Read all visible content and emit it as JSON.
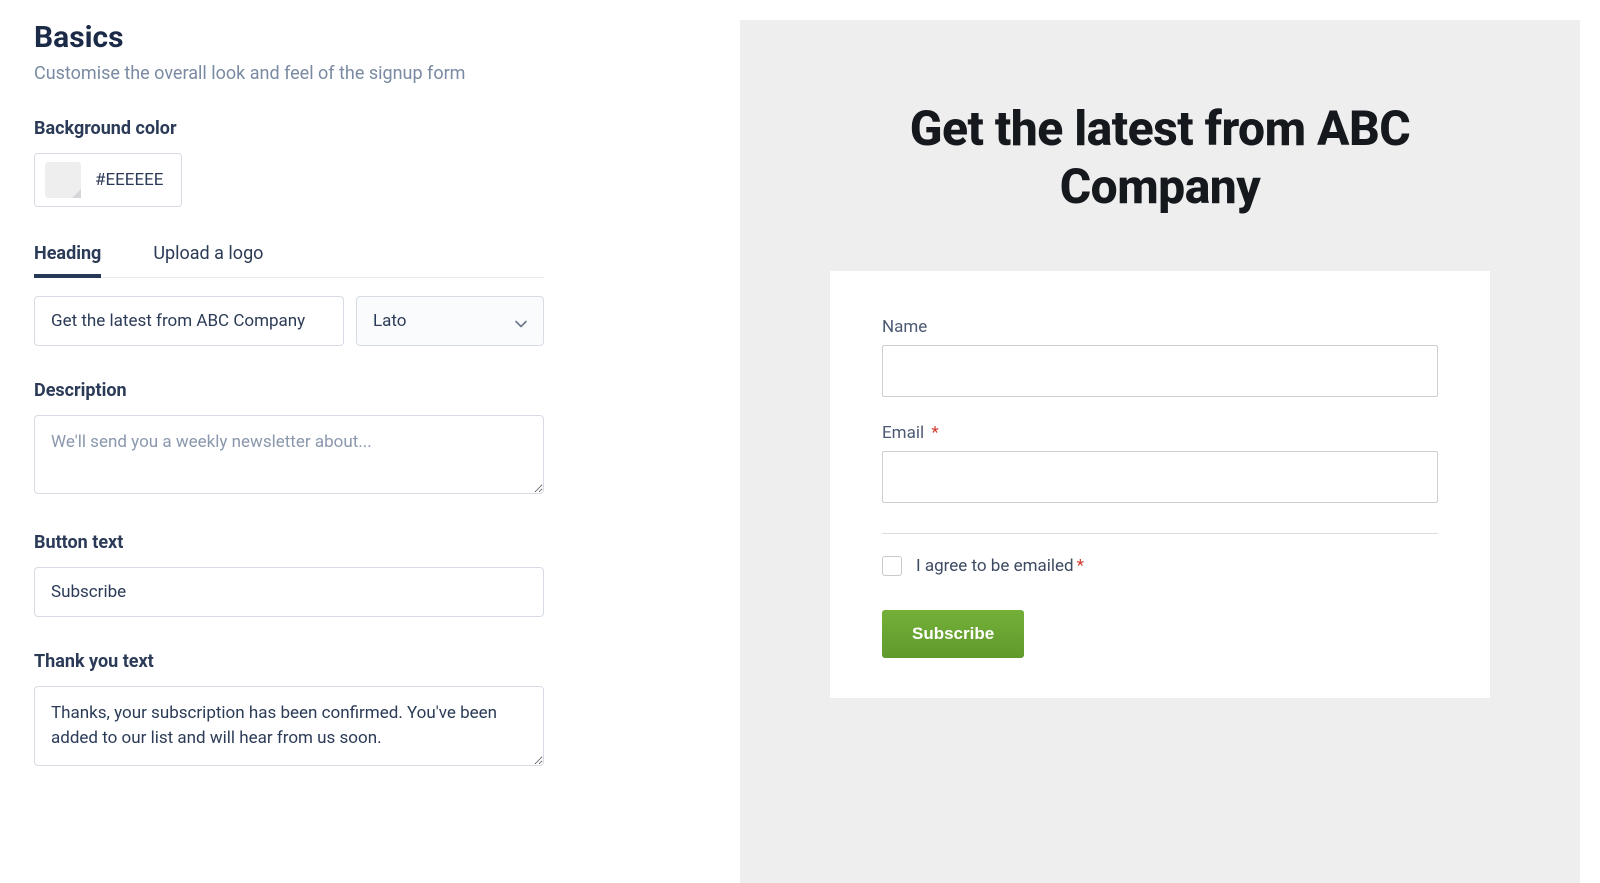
{
  "left": {
    "title": "Basics",
    "subtitle": "Customise the overall look and feel of the signup form",
    "bg_label": "Background color",
    "bg_value": "#EEEEEE",
    "tabs": {
      "heading": "Heading",
      "logo": "Upload a logo"
    },
    "heading_value": "Get the latest from ABC Company",
    "font_selected": "Lato",
    "desc_label": "Description",
    "desc_placeholder": "We'll send you a weekly newsletter about...",
    "desc_value": "",
    "button_label": "Button text",
    "button_value": "Subscribe",
    "thanks_label": "Thank you text",
    "thanks_value": "Thanks, your subscription has been confirmed. You've been added to our list and will hear from us soon."
  },
  "preview": {
    "heading": "Get the latest from ABC Company",
    "name_label": "Name",
    "email_label": "Email",
    "consent_text": "I agree to be emailed",
    "button_text": "Subscribe",
    "email_required": "*",
    "consent_required": "*"
  }
}
